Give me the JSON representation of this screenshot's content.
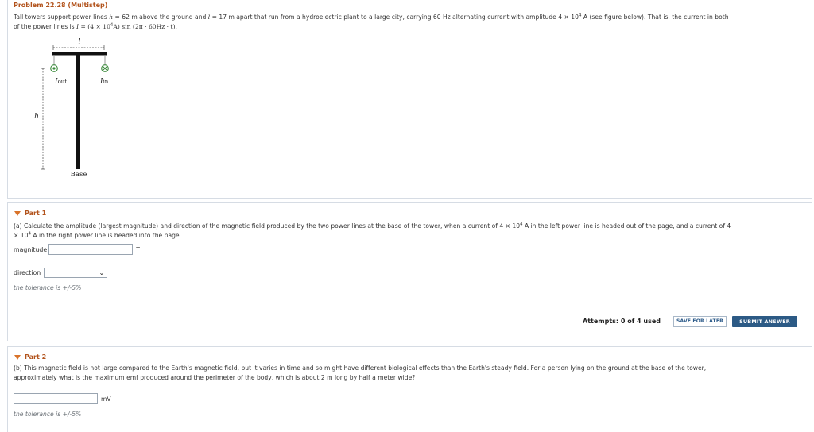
{
  "problem": {
    "title": "Problem 22.28 (Multistep)",
    "text_line1_a": "Tall towers support power lines ",
    "h_sym": "h",
    "eq1": " = 62 m above the ground and ",
    "l_sym": "l",
    "eq2": " = 17 m apart that run from a hydroelectric plant to a large city, carrying 60 Hz alternating current with amplitude 4 × 10",
    "exp4": "4",
    "text_line1_b": " A (see figure below). That is, the current in both",
    "text_line2_a": "of the power lines is ",
    "I_sym": "I",
    "eq3": " = ",
    "formula": "(4 × 10",
    "formula_exp": "4",
    "formula_b": "A) sin (2π · 60Hz · t).",
    "figure": {
      "label_l": "l",
      "label_h": "h",
      "label_iout": "I",
      "label_iout_sub": "out",
      "label_iin": "I",
      "label_iin_sub": "in",
      "label_base": "Base"
    }
  },
  "part1": {
    "header": "Part 1",
    "text_a": "(a) Calculate the amplitude (largest magnitude) and direction of the magnetic field produced by the two power lines at the base of the tower, when a current of 4 × 10",
    "exp_a": "4",
    "text_b": " A in the left power line is headed out of the page, and a current of 4",
    "text_c": "× 10",
    "exp_c": "4",
    "text_d": " A in the right power line is headed into the page.",
    "magnitude_label": "magnitude",
    "magnitude_value": "",
    "magnitude_unit": "T",
    "direction_label": "direction",
    "direction_value": "",
    "tolerance": "the tolerance is +/-5%",
    "attempts": "Attempts: 0 of 4 used",
    "save_label": "SAVE FOR LATER",
    "submit_label": "SUBMIT ANSWER"
  },
  "part2": {
    "header": "Part 2",
    "text_a": "(b) This magnetic field is not large compared to the Earth's magnetic field, but it varies in time and so might have different biological effects than the Earth's steady field. For a person lying on the ground at the base of the tower,",
    "text_b": "approximately what is the maximum emf produced around the perimeter of the body, which is about 2 m long by half a meter wide?",
    "answer_value": "",
    "unit": "mV",
    "tolerance": "the tolerance is +/-5%"
  },
  "colors": {
    "title": "#b2531c",
    "triangle": "#d9732a",
    "submit_bg": "#2c5a85",
    "border": "#d6dce4"
  }
}
